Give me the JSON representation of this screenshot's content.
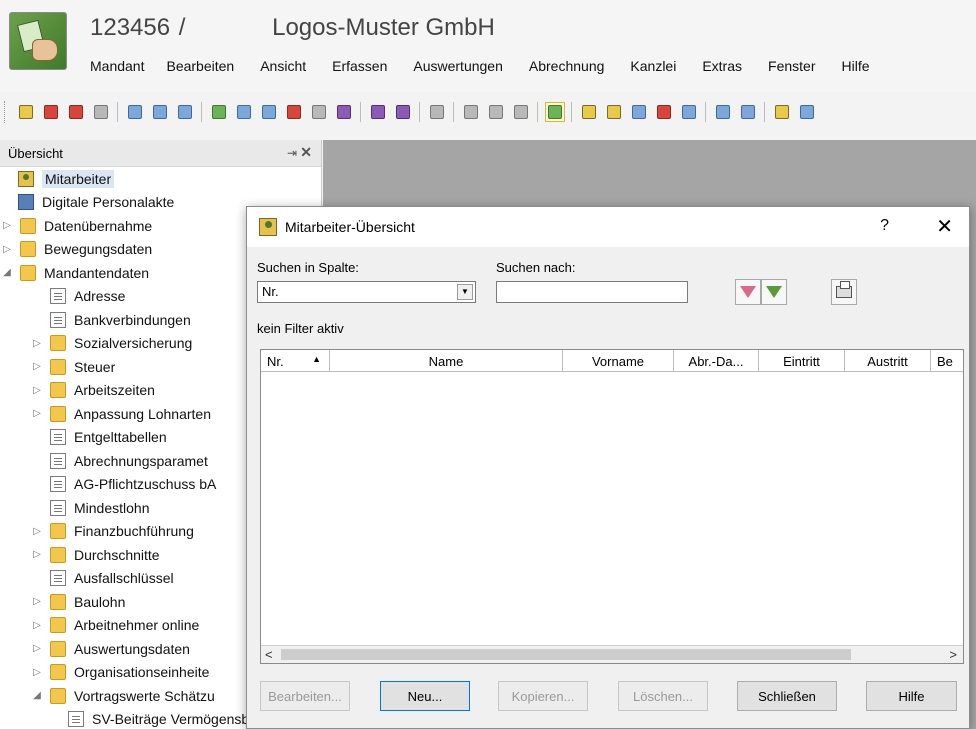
{
  "header": {
    "client_number": "123456",
    "separator": "/",
    "company_name": "Logos-Muster GmbH"
  },
  "menu": [
    "Mandant",
    "Bearbeiten",
    "Ansicht",
    "Erfassen",
    "Auswertungen",
    "Abrechnung",
    "Kanzlei",
    "Extras",
    "Fenster",
    "Hilfe"
  ],
  "nav": {
    "title": "Übersicht",
    "items": [
      {
        "label": "Mitarbeiter",
        "icon": "employee-icon",
        "exp": "",
        "indent": 0,
        "selected": true
      },
      {
        "label": "Digitale Personalakte",
        "icon": "personnel-file-icon",
        "exp": "",
        "indent": 0
      },
      {
        "label": "Datenübernahme",
        "icon": "folder-icon",
        "exp": "▷",
        "indent": 0
      },
      {
        "label": "Bewegungsdaten",
        "icon": "folder-icon",
        "exp": "▷",
        "indent": 0
      },
      {
        "label": "Mandantendaten",
        "icon": "folder-icon",
        "exp": "◢",
        "indent": 0
      },
      {
        "label": "Adresse",
        "icon": "document-icon",
        "exp": "",
        "indent": 1
      },
      {
        "label": "Bankverbindungen",
        "icon": "document-icon",
        "exp": "",
        "indent": 1
      },
      {
        "label": "Sozialversicherung",
        "icon": "folder-icon",
        "exp": "▷",
        "indent": 1
      },
      {
        "label": "Steuer",
        "icon": "folder-icon",
        "exp": "▷",
        "indent": 1
      },
      {
        "label": "Arbeitszeiten",
        "icon": "folder-icon",
        "exp": "▷",
        "indent": 1
      },
      {
        "label": "Anpassung Lohnarten",
        "icon": "folder-icon",
        "exp": "▷",
        "indent": 1
      },
      {
        "label": "Entgelttabellen",
        "icon": "document-icon",
        "exp": "",
        "indent": 1
      },
      {
        "label": "Abrechnungsparamet",
        "icon": "document-icon",
        "exp": "",
        "indent": 1
      },
      {
        "label": "AG-Pflichtzuschuss bA",
        "icon": "document-icon",
        "exp": "",
        "indent": 1
      },
      {
        "label": "Mindestlohn",
        "icon": "document-icon",
        "exp": "",
        "indent": 1
      },
      {
        "label": "Finanzbuchführung",
        "icon": "folder-icon",
        "exp": "▷",
        "indent": 1
      },
      {
        "label": "Durchschnitte",
        "icon": "folder-icon",
        "exp": "▷",
        "indent": 1
      },
      {
        "label": "Ausfallschlüssel",
        "icon": "document-icon",
        "exp": "",
        "indent": 1
      },
      {
        "label": "Baulohn",
        "icon": "folder-icon",
        "exp": "▷",
        "indent": 1
      },
      {
        "label": "Arbeitnehmer online",
        "icon": "folder-icon",
        "exp": "▷",
        "indent": 1
      },
      {
        "label": "Auswertungsdaten",
        "icon": "folder-icon",
        "exp": "▷",
        "indent": 1
      },
      {
        "label": "Organisationseinheite",
        "icon": "folder-icon",
        "exp": "▷",
        "indent": 1
      },
      {
        "label": "Vortragswerte Schätzu",
        "icon": "folder-icon",
        "exp": "◢",
        "indent": 1
      },
      {
        "label": "SV-Beiträge Vermögensb",
        "icon": "document-icon",
        "exp": "",
        "indent": 2
      }
    ]
  },
  "dialog": {
    "title": "Mitarbeiter-Übersicht",
    "help_symbol": "?",
    "close_symbol": "✕",
    "search_column_label": "Suchen in Spalte:",
    "search_column_value": "Nr.",
    "search_for_label": "Suchen nach:",
    "search_for_value": "",
    "filter_status": "kein Filter aktiv",
    "columns": [
      "Nr.",
      "Name",
      "Vorname",
      "Abr.-Da...",
      "Eintritt",
      "Austritt",
      "Be"
    ],
    "sort_indicator": "▲",
    "buttons": {
      "edit": "Bearbeiten...",
      "new": "Neu...",
      "copy": "Kopieren...",
      "delete": "Löschen...",
      "close": "Schließen",
      "help": "Hilfe"
    }
  }
}
